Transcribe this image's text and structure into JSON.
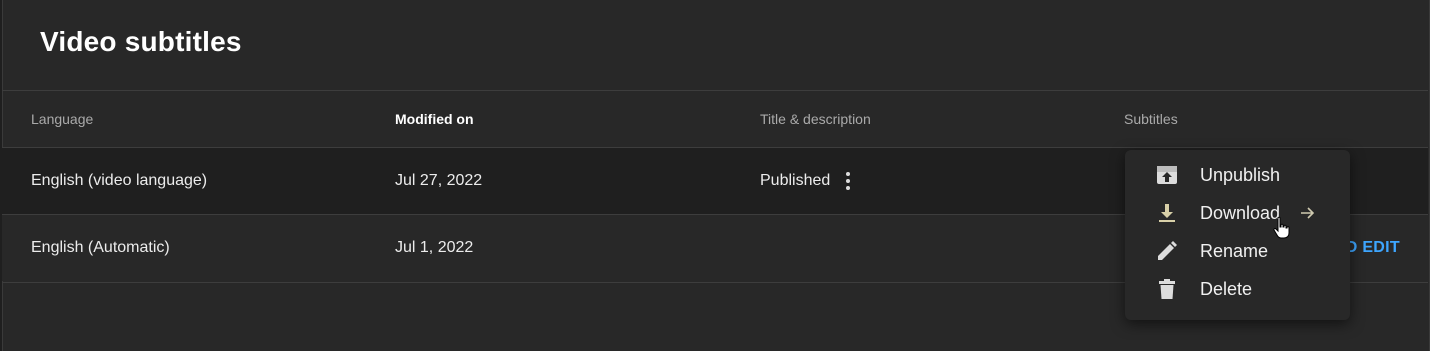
{
  "page": {
    "title": "Video subtitles"
  },
  "table": {
    "headers": {
      "language": "Language",
      "modified_on": "Modified on",
      "title_description": "Title & description",
      "subtitles": "Subtitles"
    },
    "rows": [
      {
        "language": "English (video language)",
        "modified": "Jul 27, 2022",
        "title_status": "Published"
      },
      {
        "language": "English (Automatic)",
        "modified": "Jul 1, 2022",
        "subtitles_action": "DUPLICATE AND EDIT"
      }
    ]
  },
  "context_menu": {
    "items": [
      {
        "label": "Unpublish",
        "icon": "unpublish-icon"
      },
      {
        "label": "Download",
        "icon": "download-icon",
        "highlighted": true
      },
      {
        "label": "Rename",
        "icon": "pencil-icon"
      },
      {
        "label": "Delete",
        "icon": "trash-icon"
      }
    ]
  },
  "colors": {
    "accent": "#3ea6ff",
    "focus_border": "#1a3cff",
    "highlight": "#4a4320"
  }
}
